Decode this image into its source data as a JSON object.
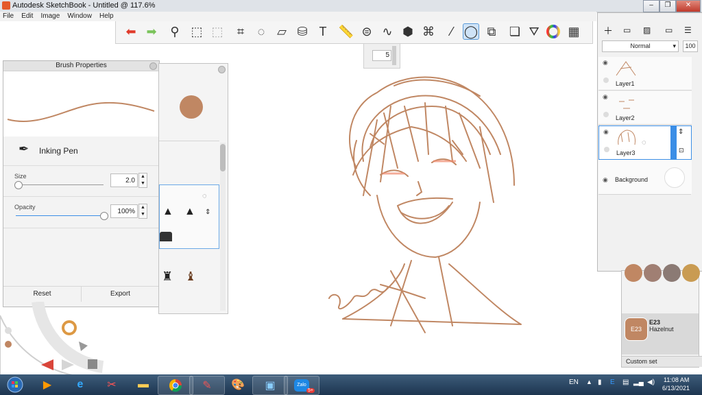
{
  "window": {
    "title": "Autodesk SketchBook - Untitled @ 117.6%",
    "minimize": "–",
    "restore": "❐",
    "close": "✕"
  },
  "menu": [
    "File",
    "Edit",
    "Image",
    "Window",
    "Help"
  ],
  "size_popup": {
    "value": "5"
  },
  "brush_properties": {
    "title": "Brush Properties",
    "brush_name": "Inking Pen",
    "size_label": "Size",
    "size_value": "2.0",
    "size_level": 0.02,
    "opacity_label": "Opacity",
    "opacity_value": "100%",
    "opacity_level": 1.0,
    "reset": "Reset",
    "export": "Export",
    "stroke_color": "#c08763"
  },
  "layers": {
    "blend_mode": "Normal",
    "opacity": "100",
    "items": [
      {
        "name": "Layer1"
      },
      {
        "name": "Layer2"
      },
      {
        "name": "Layer3"
      },
      {
        "name": "Background"
      }
    ]
  },
  "color_set": {
    "selected_code": "E23",
    "selected_name": "Hazelnut",
    "selected_color": "#c08763",
    "swatch_code": "E23",
    "set_name": "Custom set"
  },
  "taskbar": {
    "lang": "EN",
    "time": "11:08 AM",
    "date": "6/13/2021",
    "zalo_label": "Zalo",
    "zalo_badge": "5+"
  }
}
